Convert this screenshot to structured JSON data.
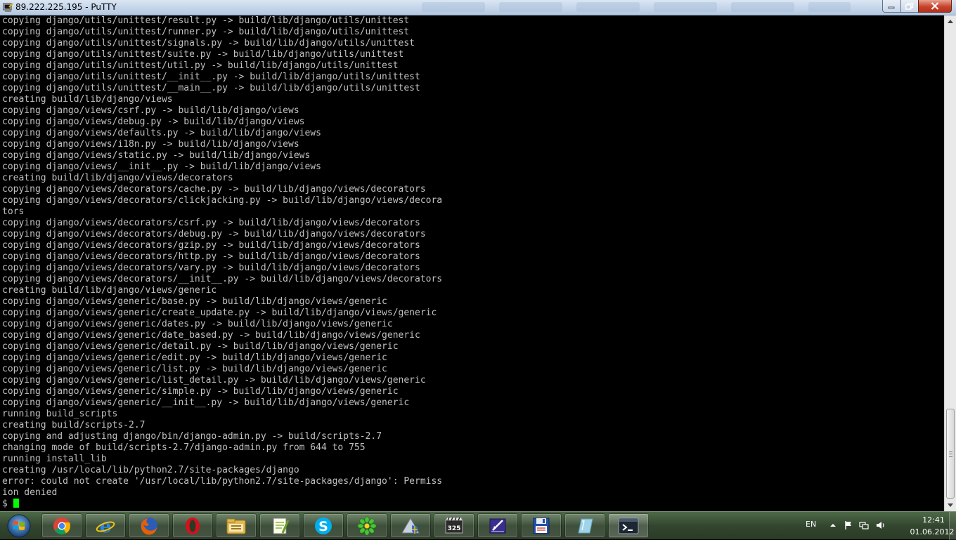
{
  "window": {
    "title": "89.222.225.195 - PuTTY"
  },
  "terminal": {
    "lines": [
      "copying django/utils/unittest/result.py -> build/lib/django/utils/unittest",
      "copying django/utils/unittest/runner.py -> build/lib/django/utils/unittest",
      "copying django/utils/unittest/signals.py -> build/lib/django/utils/unittest",
      "copying django/utils/unittest/suite.py -> build/lib/django/utils/unittest",
      "copying django/utils/unittest/util.py -> build/lib/django/utils/unittest",
      "copying django/utils/unittest/__init__.py -> build/lib/django/utils/unittest",
      "copying django/utils/unittest/__main__.py -> build/lib/django/utils/unittest",
      "creating build/lib/django/views",
      "copying django/views/csrf.py -> build/lib/django/views",
      "copying django/views/debug.py -> build/lib/django/views",
      "copying django/views/defaults.py -> build/lib/django/views",
      "copying django/views/i18n.py -> build/lib/django/views",
      "copying django/views/static.py -> build/lib/django/views",
      "copying django/views/__init__.py -> build/lib/django/views",
      "creating build/lib/django/views/decorators",
      "copying django/views/decorators/cache.py -> build/lib/django/views/decorators",
      "copying django/views/decorators/clickjacking.py -> build/lib/django/views/decora",
      "tors",
      "copying django/views/decorators/csrf.py -> build/lib/django/views/decorators",
      "copying django/views/decorators/debug.py -> build/lib/django/views/decorators",
      "copying django/views/decorators/gzip.py -> build/lib/django/views/decorators",
      "copying django/views/decorators/http.py -> build/lib/django/views/decorators",
      "copying django/views/decorators/vary.py -> build/lib/django/views/decorators",
      "copying django/views/decorators/__init__.py -> build/lib/django/views/decorators",
      "creating build/lib/django/views/generic",
      "copying django/views/generic/base.py -> build/lib/django/views/generic",
      "copying django/views/generic/create_update.py -> build/lib/django/views/generic",
      "copying django/views/generic/dates.py -> build/lib/django/views/generic",
      "copying django/views/generic/date_based.py -> build/lib/django/views/generic",
      "copying django/views/generic/detail.py -> build/lib/django/views/generic",
      "copying django/views/generic/edit.py -> build/lib/django/views/generic",
      "copying django/views/generic/list.py -> build/lib/django/views/generic",
      "copying django/views/generic/list_detail.py -> build/lib/django/views/generic",
      "copying django/views/generic/simple.py -> build/lib/django/views/generic",
      "copying django/views/generic/__init__.py -> build/lib/django/views/generic",
      "running build_scripts",
      "creating build/scripts-2.7",
      "copying and adjusting django/bin/django-admin.py -> build/scripts-2.7",
      "changing mode of build/scripts-2.7/django-admin.py from 644 to 755",
      "running install_lib",
      "creating /usr/local/lib/python2.7/site-packages/django",
      "error: could not create '/usr/local/lib/python2.7/site-packages/django': Permiss",
      "ion denied"
    ],
    "prompt": "$ "
  },
  "taskbar": {
    "apps": [
      {
        "name": "chrome-icon"
      },
      {
        "name": "internet-explorer-icon"
      },
      {
        "name": "firefox-icon"
      },
      {
        "name": "opera-icon"
      },
      {
        "name": "file-explorer-icon"
      },
      {
        "name": "notepad-plus-icon"
      },
      {
        "name": "skype-icon"
      },
      {
        "name": "icq-icon"
      },
      {
        "name": "setup-shield-icon"
      },
      {
        "name": "media-player-classic-icon"
      },
      {
        "name": "text-editor-icon"
      },
      {
        "name": "floppy-disk-icon"
      },
      {
        "name": "glass-panel-icon"
      },
      {
        "name": "putty-terminal-icon"
      }
    ]
  },
  "tray": {
    "language": "EN",
    "time": "12:41",
    "date": "01.06.2012"
  },
  "colors": {
    "terminal_bg": "#000000",
    "terminal_fg": "#c0c0c0",
    "cursor": "#00ff00"
  }
}
